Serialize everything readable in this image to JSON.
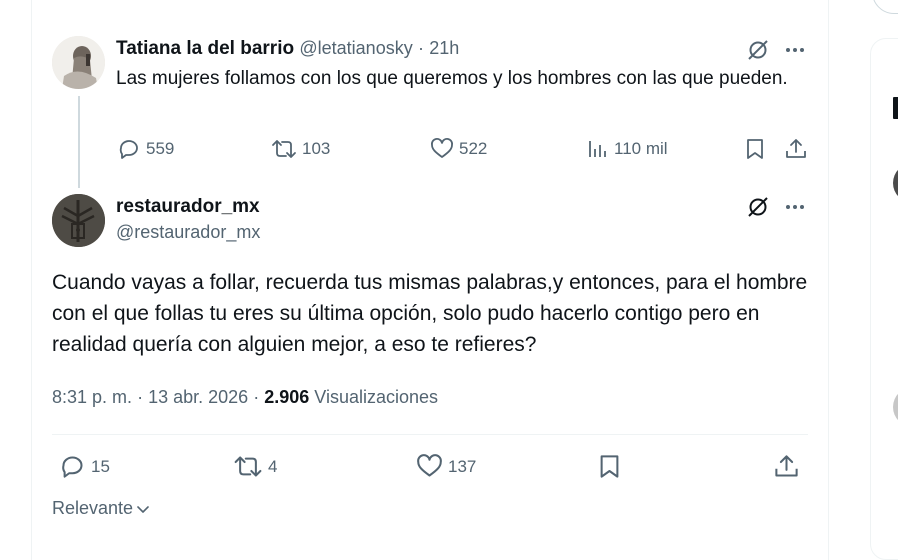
{
  "parent_post": {
    "display_name": "Tatiana la del barrio",
    "handle": "@letatianosky",
    "separator": "·",
    "time": "21h",
    "text": "Las mujeres follamos con los que queremos y los hombres con las que pueden.",
    "actions": {
      "replies": "559",
      "reposts": "103",
      "likes": "522",
      "views": "110 mil"
    }
  },
  "main_post": {
    "display_name": "restaurador_mx",
    "handle": "@restaurador_mx",
    "text": "Cuando vayas a follar, recuerda tus mismas palabras,y entonces, para el hombre con el que follas tu eres su última opción, solo pudo hacerlo contigo pero en realidad quería con alguien mejor, a eso te refieres?",
    "time": "8:31 p. m.",
    "separator": "·",
    "date": "13 abr. 2026",
    "views_count": "2.906",
    "views_label": "Visualizaciones",
    "actions": {
      "replies": "15",
      "reposts": "4",
      "likes": "137"
    }
  },
  "reply_sort": {
    "label": "Relevante"
  },
  "icons": {
    "grok": "grok-icon",
    "more": "more-icon",
    "reply": "reply-icon",
    "repost": "repost-icon",
    "like": "like-icon",
    "views": "views-icon",
    "bookmark": "bookmark-icon",
    "share": "share-icon",
    "chevron": "chevron-down-icon"
  },
  "colors": {
    "text_primary": "#0f1419",
    "text_secondary": "#536471",
    "border": "#eff3f4",
    "thread_line": "#cfd9de"
  }
}
